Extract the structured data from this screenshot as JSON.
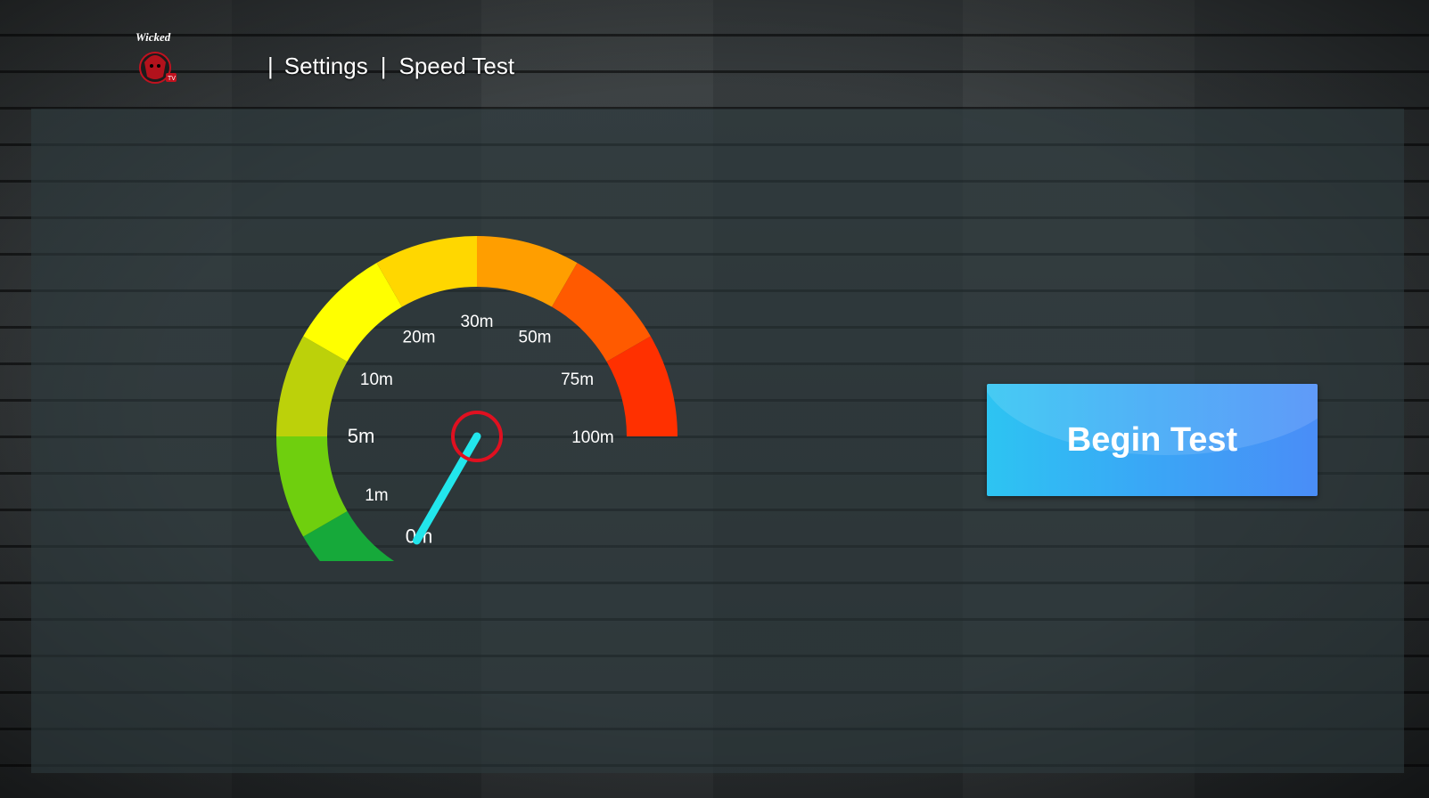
{
  "header": {
    "logo_text": "Wicked TV",
    "breadcrumb": {
      "separator": "|",
      "items": [
        "Settings",
        "Speed Test"
      ]
    }
  },
  "speed_gauge": {
    "tick_labels": [
      "0m",
      "1m",
      "5m",
      "10m",
      "20m",
      "30m",
      "50m",
      "75m",
      "100m"
    ],
    "current_value": "0m",
    "needle_color": "#22e6ec",
    "hub_color": "#e01020",
    "arc_colors": [
      "#16a93a",
      "#6fcf0e",
      "#bcd10a",
      "#ffff00",
      "#ffd700",
      "#ff9e00",
      "#ff5a00",
      "#ff3000"
    ]
  },
  "actions": {
    "begin_test_label": "Begin Test"
  },
  "colors": {
    "accent_start": "#2dc4f2",
    "accent_end": "#4a8df7"
  }
}
